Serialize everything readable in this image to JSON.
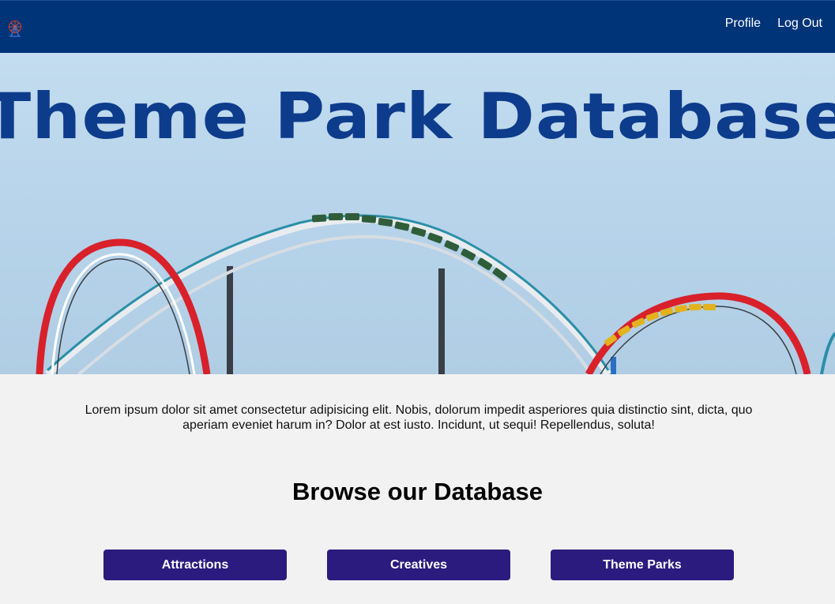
{
  "nav": {
    "logo_icon": "ferris-wheel-icon",
    "links": [
      {
        "label": "Profile"
      },
      {
        "label": "Log Out"
      }
    ],
    "background": "#003478"
  },
  "hero": {
    "title": "Theme Park Database",
    "title_color": "#0e3c8c",
    "image": "roller-coaster-photo"
  },
  "intro": {
    "text": "Lorem ipsum dolor sit amet consectetur adipisicing elit. Nobis, dolorum impedit asperiores quia distinctio sint, dicta, quo aperiam eveniet harum in? Dolor at est iusto. Incidunt, ut sequi! Repellendus, soluta!"
  },
  "browse": {
    "title": "Browse our Database",
    "buttons": [
      {
        "label": "Attractions"
      },
      {
        "label": "Creatives"
      },
      {
        "label": "Theme Parks"
      }
    ],
    "button_color": "#2c1b7f"
  }
}
